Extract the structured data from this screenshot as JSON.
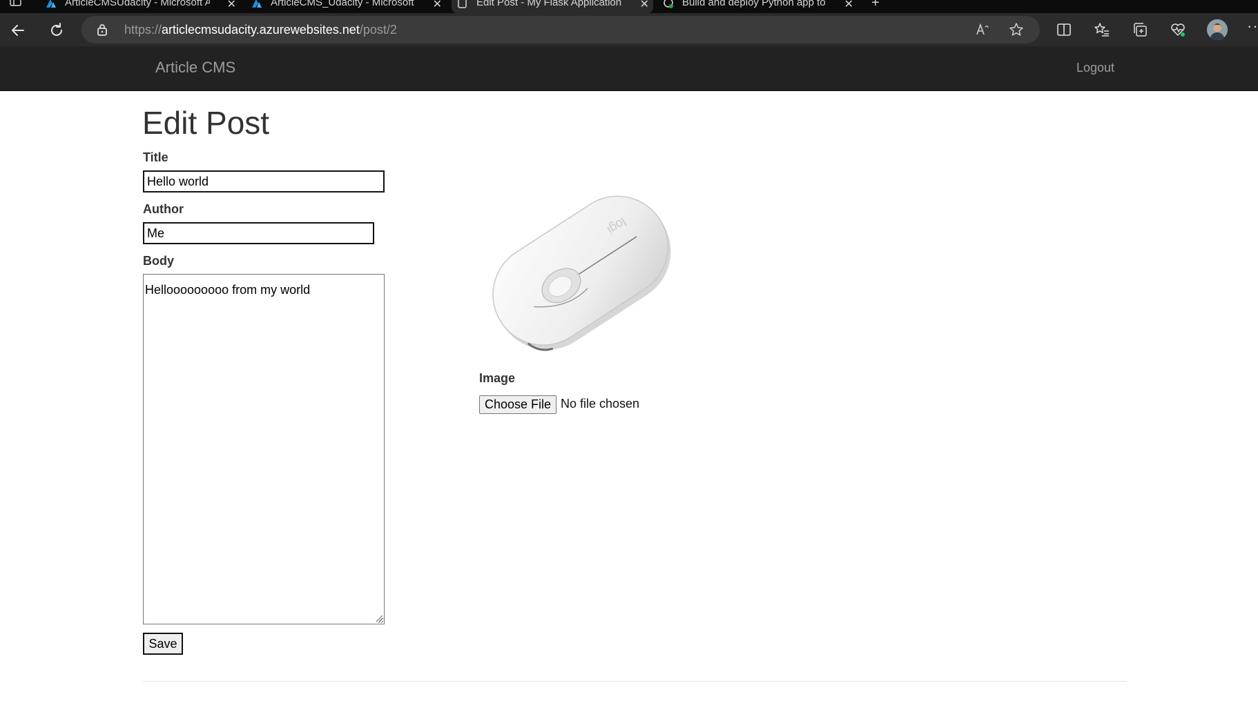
{
  "browser": {
    "tabs": [
      {
        "title": "ArticleCMSUdacity - Microsoft A",
        "favicon": "azure-icon"
      },
      {
        "title": "ArticleCMS_Udacity - Microsoft A",
        "favicon": "azure-icon"
      },
      {
        "title": "Edit Post - My Flask Application",
        "favicon": "page-icon",
        "active": true
      },
      {
        "title": "Build and deploy Python app to",
        "favicon": "github-icon"
      }
    ],
    "url_host": "articlecmsudacity.azurewebsites.net",
    "url_scheme": "https://",
    "url_path": "/post/2"
  },
  "navbar": {
    "brand": "Article CMS",
    "logout": "Logout"
  },
  "page": {
    "heading": "Edit Post",
    "title_label": "Title",
    "title_value": "Hello world",
    "author_label": "Author",
    "author_value": "Me",
    "body_label": "Body",
    "body_value": "Hellooooooooo from my world",
    "save_label": "Save",
    "image_label": "Image",
    "choose_file_label": "Choose File",
    "no_file_text": "No file chosen",
    "image_brand_text": "logi"
  },
  "colors": {
    "navbar_bg": "#222222",
    "navbar_text": "#9d9d9d",
    "chrome_bg": "#2b2b2b"
  }
}
